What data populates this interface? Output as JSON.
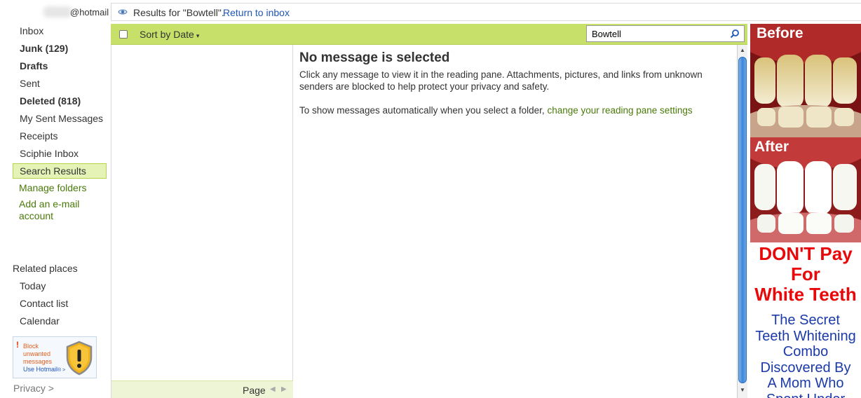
{
  "account": {
    "email_suffix": "@hotmail"
  },
  "sidebar": {
    "folders": [
      {
        "label": "Inbox",
        "bold": false
      },
      {
        "label": "Junk (129)",
        "bold": true
      },
      {
        "label": "Drafts",
        "bold": true
      },
      {
        "label": "Sent",
        "bold": false
      },
      {
        "label": "Deleted (818)",
        "bold": true
      },
      {
        "label": "My Sent Messages",
        "bold": false
      },
      {
        "label": "Receipts",
        "bold": false
      },
      {
        "label": "Sciphie Inbox",
        "bold": false
      },
      {
        "label": "Search Results",
        "bold": false,
        "selected": true
      }
    ],
    "manage_folders": "Manage folders",
    "add_account_line1": "Add an e-mail",
    "add_account_line2": "account",
    "related_heading": "Related places",
    "related": [
      "Today",
      "Contact list",
      "Calendar"
    ],
    "promo": {
      "line1": "Block",
      "line2": "unwanted",
      "line3": "messages",
      "cta": "Use Hotmail",
      "cta_suffix": "® >",
      "icon": "shield-warning-icon"
    },
    "privacy": "Privacy",
    "privacy_arrow": ">"
  },
  "topbar": {
    "results_text": "Results for \"Bowtell\".",
    "return_link": "Return to inbox",
    "icon": "search-results-icon"
  },
  "toolbar": {
    "sort_label": "Sort by Date",
    "sort_arrow": "▾",
    "search_value": "Bowtell",
    "search_icon": "magnifier-icon"
  },
  "list": {
    "page_label": "Page",
    "prev": "◀",
    "next": "▶"
  },
  "reading": {
    "heading": "No message is selected",
    "body": "Click any message to view it in the reading pane. Attachments, pictures, and links from unknown senders are blocked to help protect your privacy and safety.",
    "auto_text": "To show messages automatically when you select a folder, ",
    "auto_link": "change your reading pane settings"
  },
  "scrollbar": {
    "up": "▲",
    "down": "▼"
  },
  "ad": {
    "before": "Before",
    "after": "After",
    "headline1": "DON'T Pay",
    "headline2": "For",
    "headline3": "White Teeth",
    "sub1": "The Secret",
    "sub2": "Teeth Whitening",
    "sub3": "Combo",
    "sub4": "Discovered By",
    "sub5": "A Mom Who",
    "sub6": "Spent Under"
  },
  "colors": {
    "toolbar_green": "#c6e06a",
    "selected_folder": "#e5f3b6",
    "link_blue": "#1f57b8",
    "link_green": "#4a7a0a",
    "ad_red": "#e8080a",
    "ad_blue": "#1b3aa8"
  }
}
